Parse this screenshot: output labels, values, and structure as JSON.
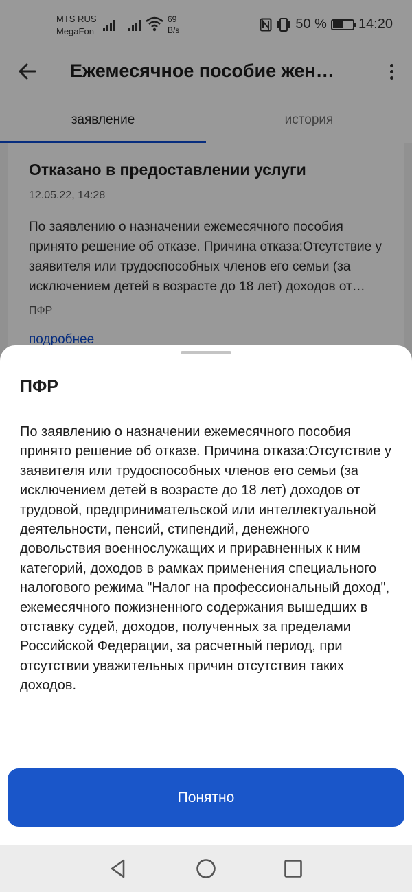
{
  "status_bar": {
    "carrier_1": "MTS RUS",
    "carrier_2": "MegaFon",
    "net_speed_value": "69",
    "net_speed_unit": "B/s",
    "battery": "50 %",
    "time": "14:20"
  },
  "app_bar": {
    "title": "Ежемесячное пособие жен…"
  },
  "tabs": [
    {
      "label": "заявление",
      "active": true
    },
    {
      "label": "история",
      "active": false
    }
  ],
  "card": {
    "title": "Отказано в предоставлении услуги",
    "date": "12.05.22, 14:28",
    "text": "По заявлению о назначении ежемесячного пособия принято решение об отказе. Причина отказа:Отсутствие у заявителя или трудоспособных членов его семьи (за исключением детей в возрасте до 18 лет) доходов от трудовой, предпринимательской или интеллектуальной деятельности, пенсий, стипендий, денежного довольствия военнослужащих и приравненных к ним категорий, доходов в рамках применения специального налогового режима \"Налог на профессиональный доход\", ежемесячного пожизненного содержания вышедших в отставку судей, доходов, полученных за пределами Российской Федерации, за расчетный период, при отсутствии уважительных причин отсутствия таких доходов.",
    "source": "ПФР",
    "link": "подробнее"
  },
  "sheet": {
    "title": "ПФР",
    "text": "По заявлению о назначении ежемесячного пособия принято решение об отказе. Причина отказа:Отсутствие у заявителя или трудоспособных членов его семьи (за исключением детей в возрасте до 18 лет) доходов от трудовой, предпринимательской или интеллектуальной деятельности, пенсий, стипендий, денежного довольствия военнослужащих и приравненных к ним категорий, доходов в рамках применения специального налогового режима \"Налог на профессиональный доход\", ежемесячного пожизненного содержания вышедших в отставку судей, доходов, полученных за пределами Российской Федерации, за расчетный период, при отсутствии уважительных причин отсутствия таких доходов.",
    "button_label": "Понятно"
  },
  "colors": {
    "accent": "#0d4cd3",
    "button": "#1a56c9",
    "scrim": "rgba(0,0,0,0.40)"
  },
  "icons": {
    "back": "arrow-left-icon",
    "more": "more-vertical-icon",
    "nav_back": "triangle-back-icon",
    "nav_home": "circle-home-icon",
    "nav_recent": "square-recent-icon"
  }
}
